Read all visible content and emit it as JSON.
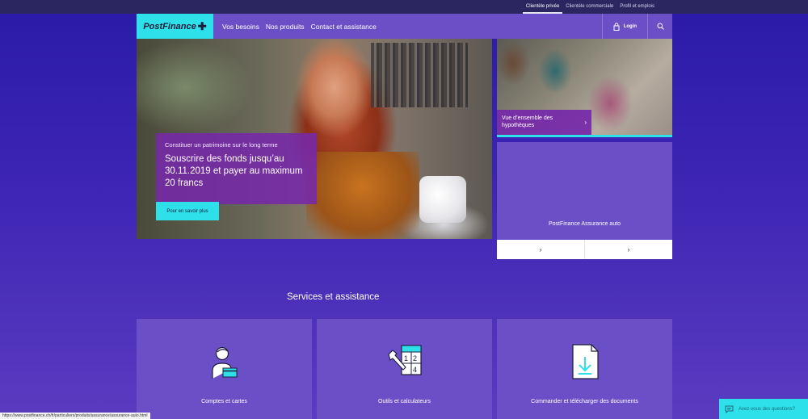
{
  "utility_nav": {
    "items": [
      {
        "label": "Clientèle privée",
        "active": true
      },
      {
        "label": "Clientèle commerciale",
        "active": false
      },
      {
        "label": "Profil et emplois",
        "active": false
      }
    ]
  },
  "header": {
    "logo_text": "PostFinance",
    "nav": [
      "Vos besoins",
      "Nos produits",
      "Contact et assistance"
    ],
    "login_label": "Login"
  },
  "hero": {
    "kicker": "Constituer un patrimoine sur le long terme",
    "title": "Souscrire des fonds jusqu’au 30.11.2019 et payer au maximum 20 francs",
    "button_label": "Pour en savoir plus"
  },
  "teaser": {
    "label": "Vue d’ensemble des hypothèques",
    "chevron": "›"
  },
  "promo": {
    "title": "PostFinance Assurance auto",
    "actions": [
      "›",
      "›"
    ]
  },
  "services": {
    "title": "Services et assistance",
    "cards": [
      {
        "label": "Comptes et cartes",
        "icon": "person-card-icon"
      },
      {
        "label": "Outils et calculateurs",
        "icon": "tools-calculator-icon"
      },
      {
        "label": "Commander et télécharger des documents",
        "icon": "document-download-icon"
      }
    ]
  },
  "status_bar": {
    "url": "https://www.postfinance.ch/fr/particuliers/produits/assurance/assurance-auto.html"
  },
  "chat": {
    "label": "Avez-vous des questions?"
  },
  "colors": {
    "accent_cyan": "#2ee0ea",
    "purple_card": "#6b4fc6",
    "overlay_purple": "#7628aa",
    "utility_bar": "#2b2560"
  }
}
